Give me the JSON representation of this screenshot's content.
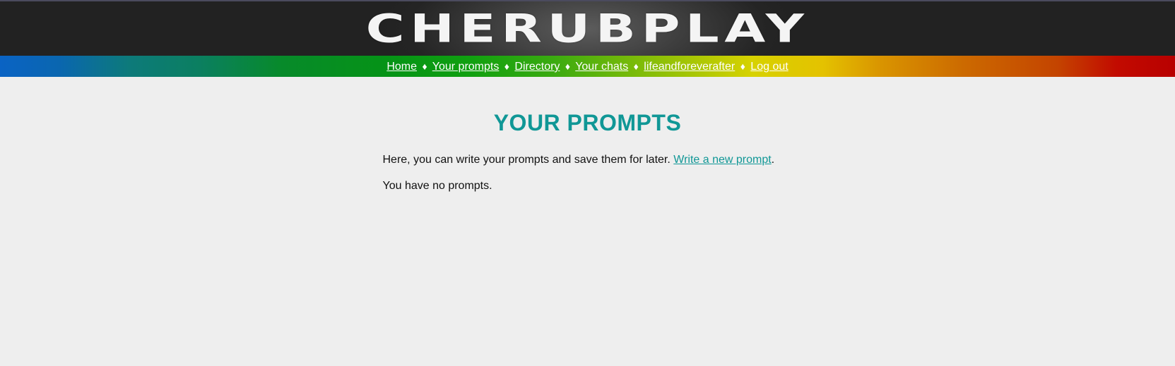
{
  "site": {
    "logo_text": "CHERUBPLAY"
  },
  "nav": {
    "items": [
      {
        "label": "Home"
      },
      {
        "label": "Your prompts"
      },
      {
        "label": "Directory"
      },
      {
        "label": "Your chats"
      },
      {
        "label": "lifeandforeverafter"
      },
      {
        "label": "Log out"
      }
    ],
    "separator": "♦"
  },
  "main": {
    "title": "YOUR PROMPTS",
    "intro_text": "Here, you can write your prompts and save them for later.",
    "new_prompt_link": "Write a new prompt",
    "intro_suffix": ".",
    "empty_message": "You have no prompts."
  },
  "colors": {
    "accent": "#109796",
    "background": "#eeeeee",
    "header_bg": "#222222"
  }
}
